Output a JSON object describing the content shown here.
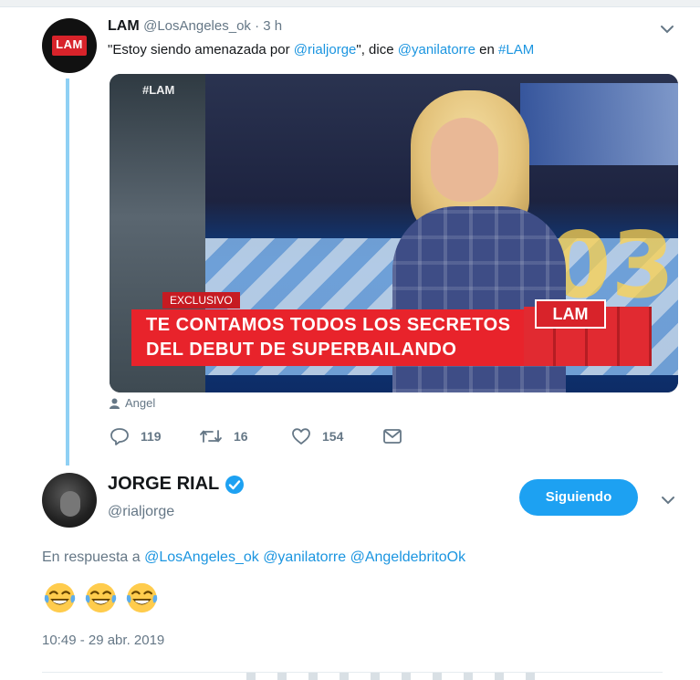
{
  "tweet1": {
    "name": "LAM",
    "handle_time": "@LosAngeles_ok · 3 h",
    "text_pre": "\"Estoy siendo amenazada por ",
    "mention1": "@rialjorge",
    "text_mid": "\", dice ",
    "mention2": "@yanilatorre",
    "text_mid2": " en ",
    "hashtag": "#LAM",
    "media": {
      "watermark": "#LAM",
      "tag": "EXCLUSIVO",
      "headline_line1": "TE CONTAMOS TODOS LOS SECRETOS",
      "headline_line2": "DEL DEBUT DE SUPERBAILANDO",
      "channel_logo": "LAM",
      "stage_number": "03"
    },
    "media_credit": "Angel",
    "avatar_logo": "LAM",
    "replies": "119",
    "retweets": "16",
    "likes": "154"
  },
  "tweet2": {
    "name": "JORGE RIAL",
    "handle": "@rialjorge",
    "follow_label": "Siguiendo",
    "reply_prefix": "En respuesta a",
    "reply_mentions": [
      "@LosAngeles_ok",
      "@yanilatorre",
      "@AngeldebritoOk"
    ],
    "emojis": "😂😂😂",
    "timestamp": "10:49 - 29 abr. 2019"
  },
  "colors": {
    "link": "#1b95e0",
    "follow_button": "#1da1f2",
    "thread_line": "#8fd0f4",
    "secondary_text": "#657786",
    "lower_third_red": "#e8232b"
  },
  "icons": [
    "chevron-down-icon",
    "user-icon",
    "reply-icon",
    "retweet-icon",
    "heart-icon",
    "mail-icon",
    "verified-badge-icon",
    "crying-laughing-emoji"
  ]
}
